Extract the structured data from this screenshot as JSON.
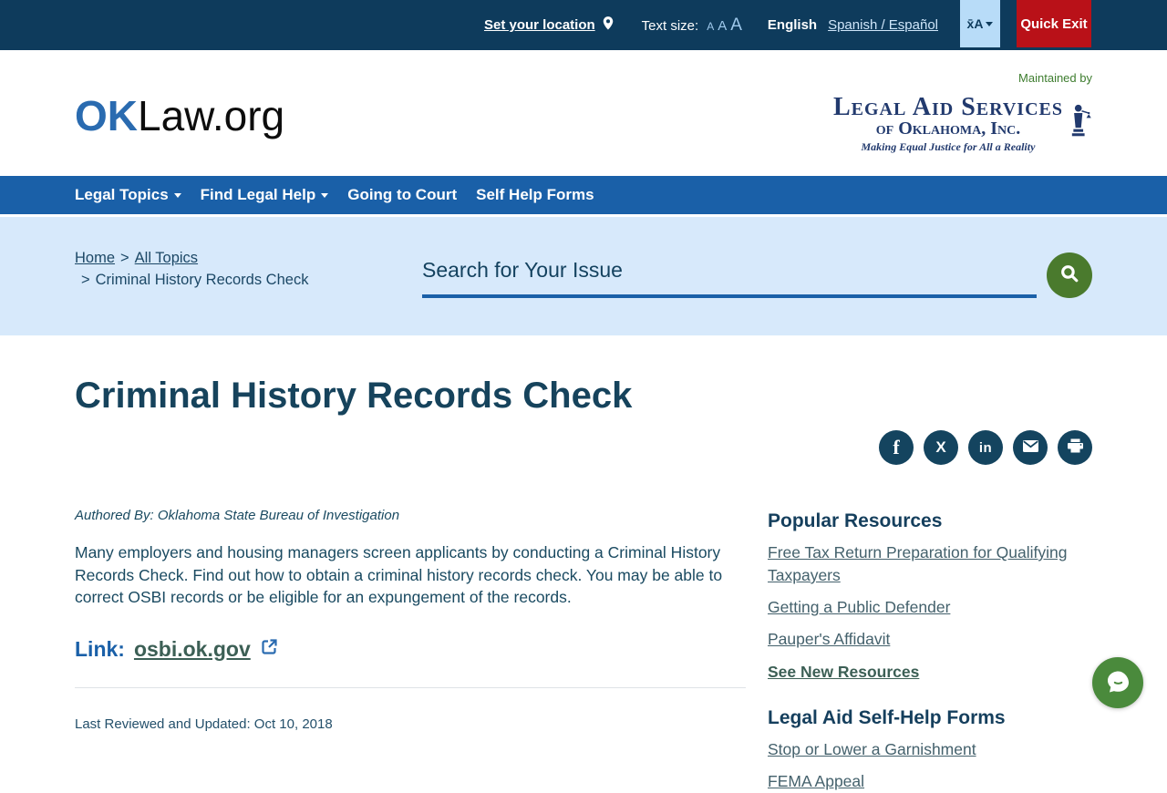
{
  "topbar": {
    "set_location": "Set your location",
    "text_size_label": "Text size:",
    "text_size_letters": [
      "A",
      "A",
      "A"
    ],
    "language_current": "English",
    "language_alt": "Spanish / Español",
    "translate_glyph": "x̄A",
    "quick_exit": "Quick Exit"
  },
  "header": {
    "logo_primary": "OK",
    "logo_secondary": "Law.org",
    "maintained_by": "Maintained by",
    "org_name_line1": "Legal Aid Services",
    "org_name_line2": "of Oklahoma, Inc.",
    "org_tagline": "Making Equal Justice for All a Reality"
  },
  "nav": {
    "items": [
      {
        "label": "Legal Topics",
        "has_dropdown": true
      },
      {
        "label": "Find Legal Help",
        "has_dropdown": true
      },
      {
        "label": "Going to Court",
        "has_dropdown": false
      },
      {
        "label": "Self Help Forms",
        "has_dropdown": false
      }
    ]
  },
  "breadcrumb": {
    "home": "Home",
    "all_topics": "All Topics",
    "separator": ">",
    "current": "Criminal History Records Check"
  },
  "search": {
    "placeholder": "Search for Your Issue"
  },
  "share": {
    "icons": [
      "facebook",
      "x-twitter",
      "linkedin",
      "email",
      "print"
    ]
  },
  "article": {
    "title": "Criminal History Records Check",
    "byline": "Authored By: Oklahoma State Bureau of Investigation",
    "body": "Many employers and housing managers screen applicants by conducting a Criminal History Records Check. Find out how to obtain a criminal history records check. You may be able to correct OSBI records or be eligible for an expungement of the records.",
    "link_label": "Link:",
    "link_text": "osbi.ok.gov",
    "last_reviewed": "Last Reviewed and Updated: Oct 10, 2018"
  },
  "sidebar": {
    "popular": {
      "title": "Popular Resources",
      "links": [
        "Free Tax Return Preparation for Qualifying Taxpayers",
        "Getting a Public Defender",
        "Pauper's Affidavit"
      ],
      "see_new": "See New Resources"
    },
    "forms": {
      "title": "Legal Aid Self-Help Forms",
      "links": [
        "Stop or Lower a Garnishment",
        "FEMA Appeal"
      ]
    }
  },
  "colors": {
    "topbar_navy": "#0e3b5c",
    "nav_blue": "#1a60a8",
    "hero_light_blue": "#d7e9fb",
    "quick_exit_red": "#b91118",
    "translate_light_blue": "#b8dcf8",
    "search_button_green": "#4a7a2d",
    "heading_teal": "#16435c",
    "maintained_by_green": "#3e7d2f",
    "chat_green": "#4a8a3c",
    "share_circle_navy": "#14445f"
  }
}
